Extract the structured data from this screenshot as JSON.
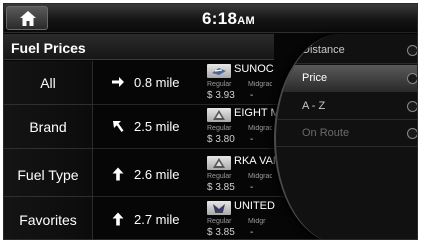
{
  "status_bar": {
    "home_icon": "home-icon",
    "time": "6:18",
    "ampm": "AM"
  },
  "header": {
    "title": "Fuel Prices"
  },
  "tabs": [
    {
      "label": "All"
    },
    {
      "label": "Brand"
    },
    {
      "label": "Fuel Type"
    },
    {
      "label": "Favorites"
    }
  ],
  "stations": [
    {
      "direction_icon": "arrow-right-icon",
      "distance": "0.8 mile",
      "brand": "SUNOC",
      "logo": "sunoco-logo-icon",
      "regular_label": "Regular",
      "midgrade_label": "Midgrac",
      "regular_price": "$ 3.93",
      "midgrade_price": "-"
    },
    {
      "direction_icon": "arrow-up-left-icon",
      "distance": "2.5 mile",
      "brand": "EIGHT M",
      "logo": "generic-station-logo-icon",
      "regular_label": "Regular",
      "midgrade_label": "Midgrade",
      "regular_price": "$ 3.80",
      "midgrade_price": "-"
    },
    {
      "direction_icon": "arrow-up-icon",
      "distance": "2.6 mile",
      "brand": "RKA VAN",
      "logo": "generic-station-logo-icon",
      "regular_label": "Regular",
      "midgrade_label": "Midgrac",
      "regular_price": "$ 3.85",
      "midgrade_price": "-"
    },
    {
      "direction_icon": "arrow-up-icon",
      "distance": "2.7 mile",
      "brand": "UNITED",
      "logo": "united-logo-icon",
      "regular_label": "Regular",
      "midgrade_label": "Midgr",
      "regular_price": "$ 3.85",
      "midgrade_price": "-"
    }
  ],
  "sort_options": [
    {
      "label": "Distance",
      "selected": false,
      "enabled": true
    },
    {
      "label": "Price",
      "selected": true,
      "enabled": true
    },
    {
      "label": "A - Z",
      "selected": false,
      "enabled": true
    },
    {
      "label": "On Route",
      "selected": false,
      "enabled": false
    }
  ],
  "colors": {
    "background": "#060606",
    "text": "#ffffff",
    "secondary_text": "#9a9a9a",
    "selected_option": "#4a4a4a"
  }
}
